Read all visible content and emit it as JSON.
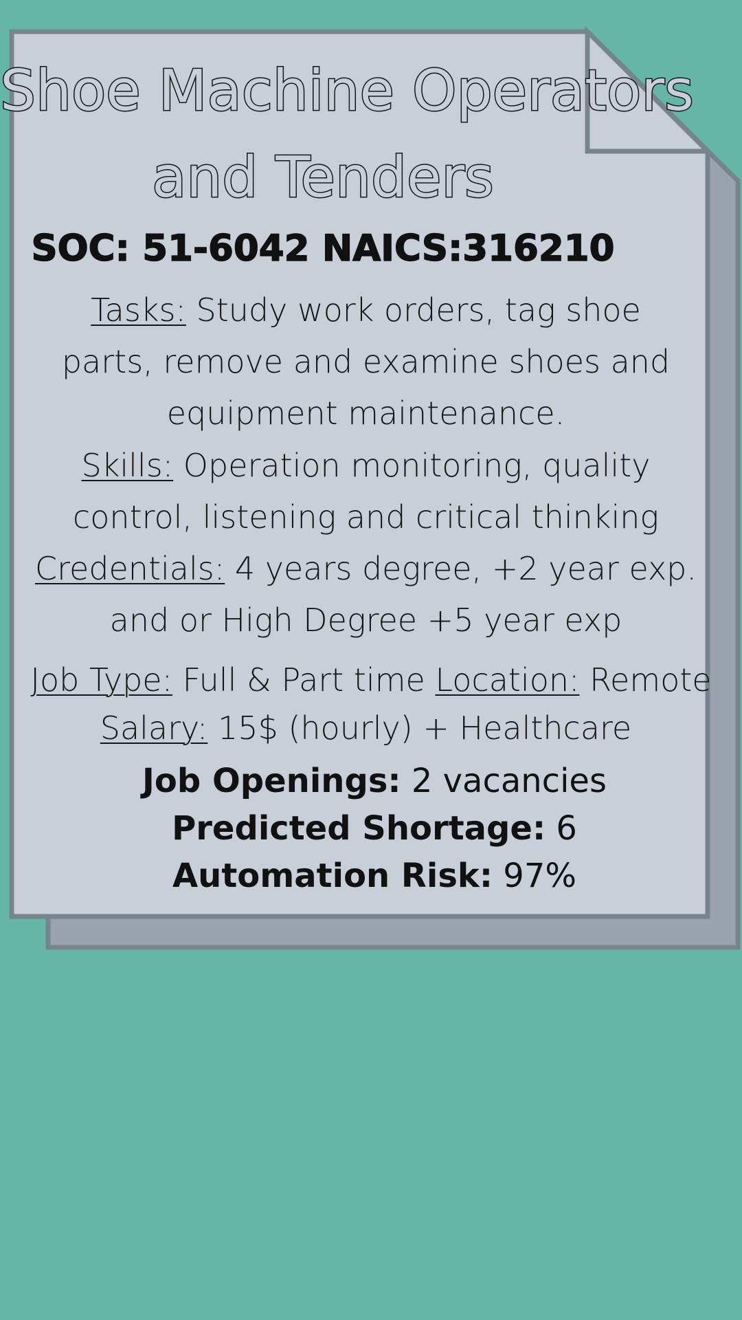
{
  "colors": {
    "background": "#66b6a8",
    "page_front": "#c9cfd8",
    "page_back": "#98a3ae",
    "border": "#76848e"
  },
  "title": {
    "line1": "Shoe Machine Operators",
    "line2": "and Tenders"
  },
  "codes": "SOC: 51-6042 NAICS:316210",
  "tasks": {
    "label": "Tasks:",
    "text": " Study work orders, tag shoe parts, remove and examine shoes and equipment maintenance."
  },
  "skills": {
    "label": "Skills:",
    "text": " Operation monitoring, quality control, listening and critical thinking"
  },
  "credentials": {
    "label": "Credentials:",
    "text": " 4 years degree, +2 year exp. and or High Degree +5 year exp"
  },
  "job_type": {
    "label": "Job Type:",
    "text": " Full & Part time "
  },
  "location": {
    "label": "Location:",
    "text": " Remote"
  },
  "salary": {
    "label": "Salary:",
    "text": " 15$ (hourly) + Healthcare"
  },
  "stats": {
    "openings_label": "Job Openings:",
    "openings_value": " 2 vacancies",
    "shortage_label": "Predicted Shortage:",
    "shortage_value": " 6",
    "risk_label": "Automation Risk:",
    "risk_value": " 97%"
  }
}
